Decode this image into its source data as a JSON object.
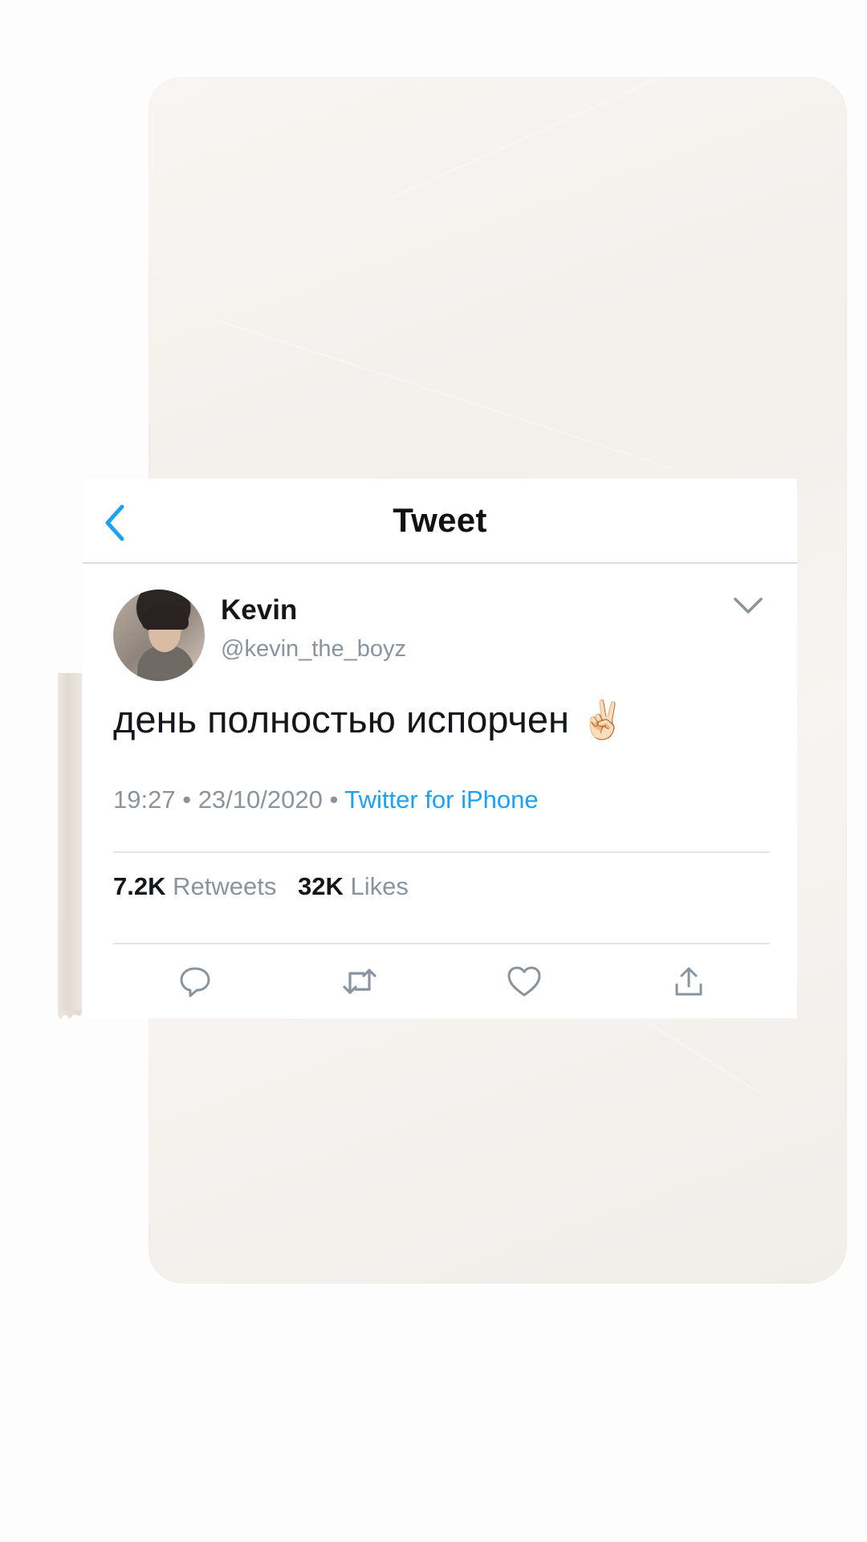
{
  "header": {
    "title": "Tweet",
    "back_icon": "chevron-left-icon"
  },
  "tweet": {
    "author_name": "Kevin",
    "author_handle": "@kevin_the_boyz",
    "text": "день полностью испорчен",
    "emoji": "✌🏻",
    "time": "19:27",
    "date": "23/10/2020",
    "separator": "•",
    "source": "Twitter for iPhone",
    "retweets_count": "7.2K",
    "retweets_label": "Retweets",
    "likes_count": "32K",
    "likes_label": "Likes"
  },
  "actions": [
    {
      "icon": "reply-icon"
    },
    {
      "icon": "retweet-icon"
    },
    {
      "icon": "like-icon"
    },
    {
      "icon": "share-icon"
    }
  ],
  "colors": {
    "accent": "#1da1f2",
    "text_primary": "#14171a",
    "text_secondary": "#8a949e",
    "paper": "#f5f2ef"
  }
}
